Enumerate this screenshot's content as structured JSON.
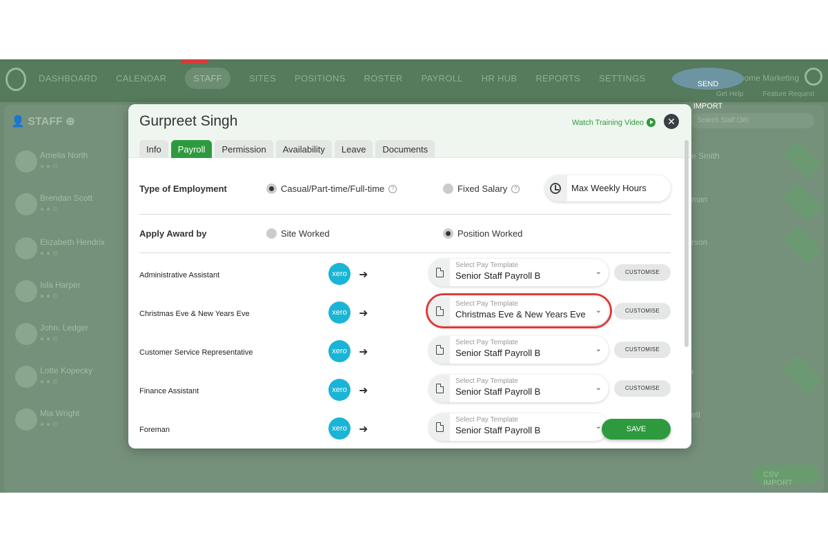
{
  "nav": {
    "items": [
      "DASHBOARD",
      "CALENDAR",
      "STAFF",
      "SITES",
      "POSITIONS",
      "ROSTER",
      "PAYROLL",
      "HR HUB",
      "REPORTS",
      "SETTINGS"
    ],
    "welcome": "Welcome Marketing",
    "get_help": "Get Help",
    "feature_request": "Feature Request"
  },
  "background": {
    "heading": "STAFF",
    "search_placeholder": "Search Staff (38)",
    "staff": [
      "Amelia North",
      "Brendan Scott",
      "Elizabeth Hendrix",
      "Isla Harper",
      "John. Ledger",
      "Lotte Kopecky",
      "Mia Wright"
    ],
    "right_names": [
      "e Smith",
      "man",
      "rson",
      "r",
      "ett"
    ],
    "xero_import": "SEND IMPORT",
    "csv_import": "CSV IMPORT"
  },
  "modal": {
    "title": "Gurpreet Singh",
    "training_link": "Watch Training Video",
    "close": "✕",
    "tabs": [
      "Info",
      "Payroll",
      "Permission",
      "Availability",
      "Leave",
      "Documents"
    ],
    "employment_label": "Type of Employment",
    "employment_option_1": "Casual/Part-time/Full-time",
    "employment_option_2": "Fixed Salary",
    "max_hours_label": "Max Weekly Hours",
    "award_label": "Apply Award by",
    "award_option_1": "Site Worked",
    "award_option_2": "Position Worked",
    "select_placeholder": "Select Pay Template",
    "customise_label": "CUSTOMISE",
    "save_label": "SAVE",
    "xero_label": "xero",
    "positions": [
      {
        "name": "Administrative Assistant",
        "template": "Senior Staff Payroll B"
      },
      {
        "name": "Christmas Eve & New Years Eve",
        "template": "Christmas Eve & New Years Eve"
      },
      {
        "name": "Customer Service Representative",
        "template": "Senior Staff Payroll B"
      },
      {
        "name": "Finance Assistant",
        "template": "Senior Staff Payroll B"
      },
      {
        "name": "Foreman",
        "template": "Senior Staff Payroll B"
      }
    ]
  }
}
